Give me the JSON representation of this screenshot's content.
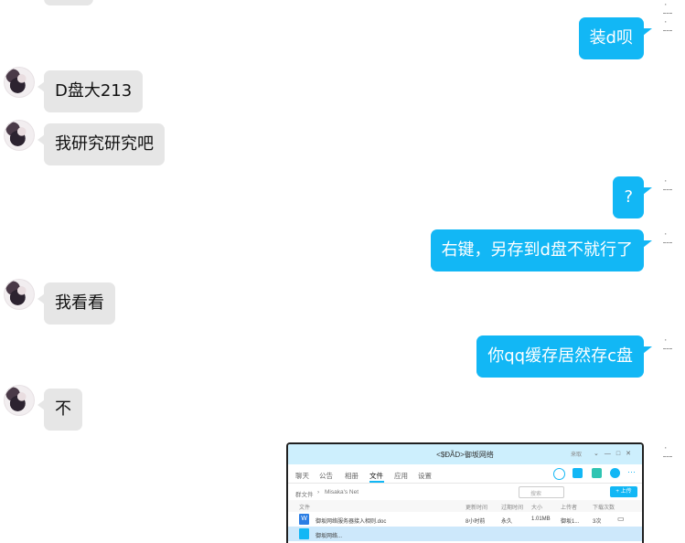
{
  "messages": [
    {
      "side": "out",
      "text": "装d呗"
    },
    {
      "side": "in",
      "text": "D盘大213"
    },
    {
      "side": "in",
      "text": "我研究研究吧"
    },
    {
      "side": "out",
      "text": "?"
    },
    {
      "side": "out",
      "text": "右键，另存到d盘不就行了"
    },
    {
      "side": "in",
      "text": "我看看"
    },
    {
      "side": "out",
      "text": "你qq缓存居然存c盘"
    },
    {
      "side": "in",
      "text": "不"
    }
  ],
  "screenshot": {
    "title": "<$ÐÃD>御坂网络",
    "status": "来取",
    "tabs": [
      "聊天",
      "公告",
      "相册",
      "文件",
      "应用",
      "设置"
    ],
    "active_tab": "文件",
    "path": [
      "群文件",
      "Misaka's Net"
    ],
    "search_placeholder": "搜索",
    "upload_label": "+ 上传",
    "columns": [
      "文件",
      "更新时间",
      "过期时间",
      "大小",
      "上传者",
      "下载次数"
    ],
    "files": [
      {
        "name": "御坂网络服务器接入相则.doc",
        "updated": "8小时前",
        "expires": "永久",
        "size": "1.01MB",
        "uploader": "御坂1...",
        "downloads": "3次"
      },
      {
        "name": "御坂网络..."
      }
    ]
  },
  "colors": {
    "out_bubble": "#12b7f5",
    "in_bubble": "#e6e6e6",
    "accent": "#12b7f5"
  }
}
